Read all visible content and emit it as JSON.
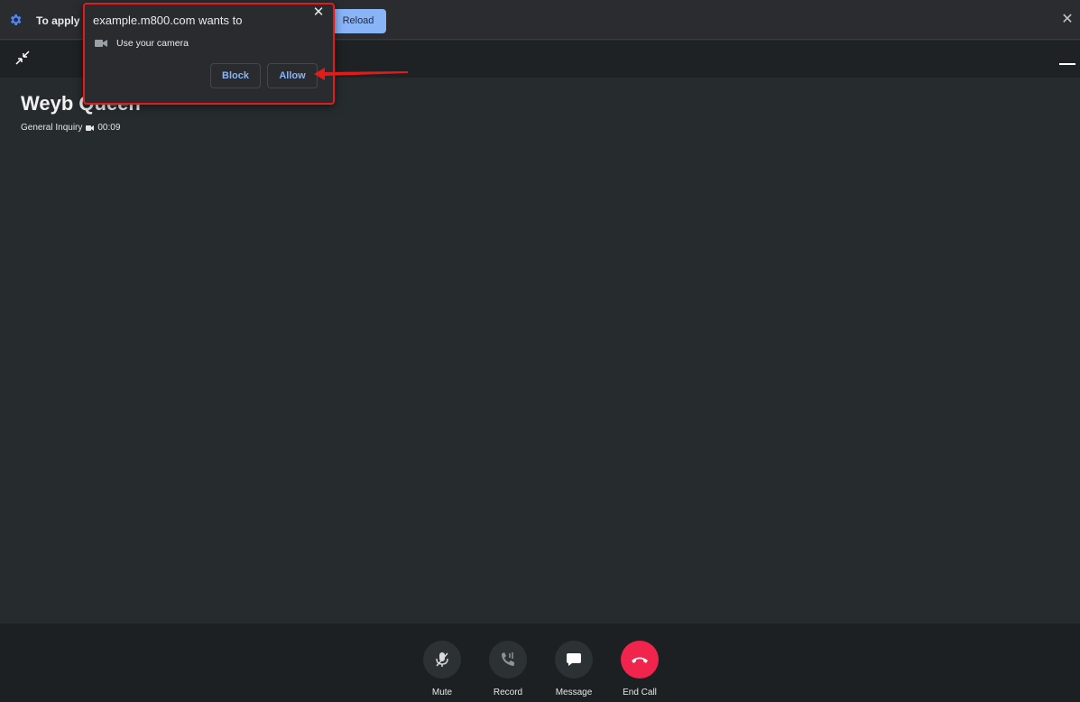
{
  "infobar": {
    "message": "To apply",
    "reload_label": "Reload",
    "icon_gear": "gear-icon",
    "icon_close": "close-icon",
    "close_glyph": "✕"
  },
  "appbar": {
    "icon_shrink": "shrink-icon",
    "icon_minimize": "minimize-icon"
  },
  "caller": {
    "name": "Weyb Queen",
    "queue": "General Inquiry",
    "duration": "00:09"
  },
  "popup": {
    "title": "example.m800.com wants to",
    "permission": "Use your camera",
    "block_label": "Block",
    "allow_label": "Allow",
    "close_glyph": "✕"
  },
  "controls": {
    "mute_label": "Mute",
    "record_label": "Record",
    "message_label": "Message",
    "end_label": "End Call"
  },
  "colors": {
    "accent": "#8ab4f8",
    "end_call": "#f0244d",
    "highlight": "#e51b1b"
  }
}
